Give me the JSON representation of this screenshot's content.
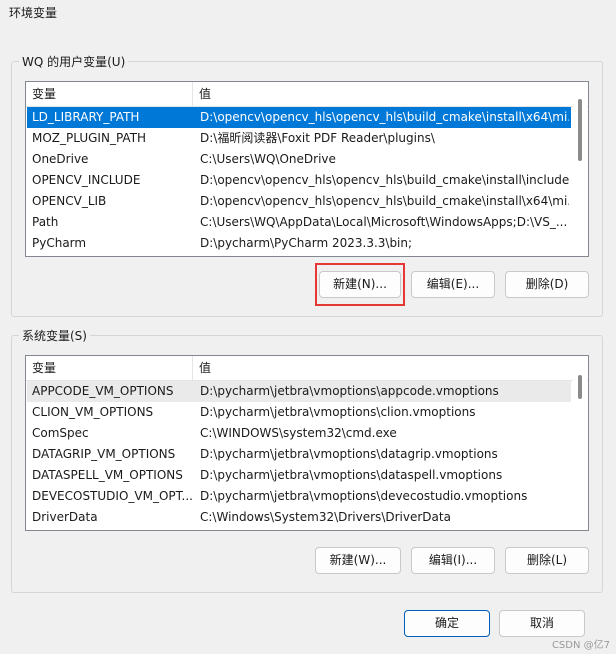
{
  "window": {
    "title": "环境变量"
  },
  "user_group": {
    "legend": "WQ 的用户变量(U)",
    "columns": [
      "变量",
      "值"
    ],
    "rows": [
      {
        "name": "LD_LIBRARY_PATH",
        "value": "D:\\opencv\\opencv_hls\\opencv_hls\\build_cmake\\install\\x64\\mi..."
      },
      {
        "name": "MOZ_PLUGIN_PATH",
        "value": "D:\\福昕阅读器\\Foxit PDF Reader\\plugins\\"
      },
      {
        "name": "OneDrive",
        "value": "C:\\Users\\WQ\\OneDrive"
      },
      {
        "name": "OPENCV_INCLUDE",
        "value": "D:\\opencv\\opencv_hls\\opencv_hls\\build_cmake\\install\\include"
      },
      {
        "name": "OPENCV_LIB",
        "value": "D:\\opencv\\opencv_hls\\opencv_hls\\build_cmake\\install\\x64\\mi..."
      },
      {
        "name": "Path",
        "value": "C:\\Users\\WQ\\AppData\\Local\\Microsoft\\WindowsApps;D:\\VS_..."
      },
      {
        "name": "PyCharm",
        "value": "D:\\pycharm\\PyCharm 2023.3.3\\bin;"
      }
    ],
    "buttons": {
      "new": "新建(N)...",
      "edit": "编辑(E)...",
      "delete": "删除(D)"
    }
  },
  "system_group": {
    "legend": "系统变量(S)",
    "columns": [
      "变量",
      "值"
    ],
    "rows": [
      {
        "name": "APPCODE_VM_OPTIONS",
        "value": "D:\\pycharm\\jetbra\\vmoptions\\appcode.vmoptions"
      },
      {
        "name": "CLION_VM_OPTIONS",
        "value": "D:\\pycharm\\jetbra\\vmoptions\\clion.vmoptions"
      },
      {
        "name": "ComSpec",
        "value": "C:\\WINDOWS\\system32\\cmd.exe"
      },
      {
        "name": "DATAGRIP_VM_OPTIONS",
        "value": "D:\\pycharm\\jetbra\\vmoptions\\datagrip.vmoptions"
      },
      {
        "name": "DATASPELL_VM_OPTIONS",
        "value": "D:\\pycharm\\jetbra\\vmoptions\\dataspell.vmoptions"
      },
      {
        "name": "DEVECOSTUDIO_VM_OPT...",
        "value": "D:\\pycharm\\jetbra\\vmoptions\\devecostudio.vmoptions"
      },
      {
        "name": "DriverData",
        "value": "C:\\Windows\\System32\\Drivers\\DriverData"
      }
    ],
    "buttons": {
      "new": "新建(W)...",
      "edit": "编辑(I)...",
      "delete": "删除(L)"
    }
  },
  "footer": {
    "ok": "确定",
    "cancel": "取消"
  },
  "watermark": "CSDN @亿7",
  "colors": {
    "selection": "#0078d7",
    "highlight_box": "#e53935",
    "primary_border": "#005fb8"
  }
}
